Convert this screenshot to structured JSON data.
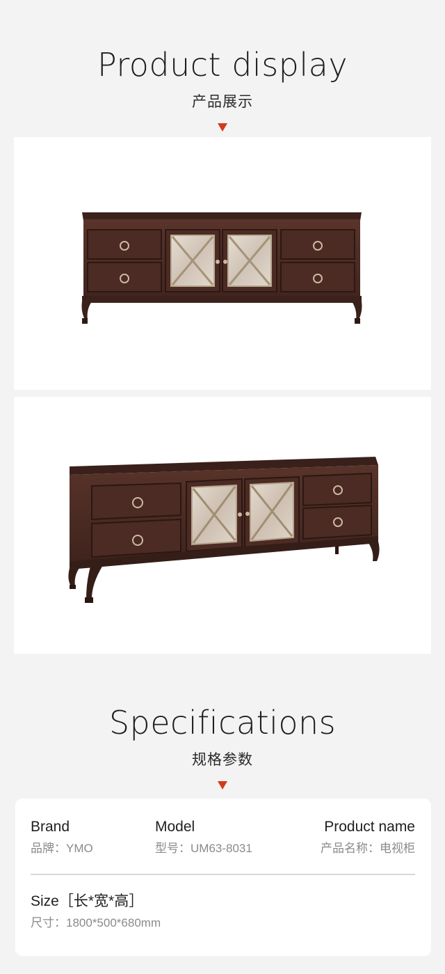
{
  "display": {
    "title_en": "Product display",
    "title_cn": "产品展示"
  },
  "specs_head": {
    "title_en": "Specifications",
    "title_cn": "规格参数"
  },
  "specs": {
    "brand_label": "Brand",
    "brand_value": "品牌：YMO",
    "model_label": "Model",
    "model_value": "型号：UM63-8031",
    "name_label": "Product name",
    "name_value": "产品名称：电视柜",
    "size_label": "Size［长*宽*高］",
    "size_value": "尺寸：1800*500*680mm"
  },
  "colors": {
    "accent": "#d33a1c",
    "background": "#f3f3f3",
    "wood": "#4a2a22",
    "mirror": "#d9d0c4"
  },
  "images": [
    {
      "subject": "tv-cabinet-front-view"
    },
    {
      "subject": "tv-cabinet-angle-view"
    }
  ]
}
